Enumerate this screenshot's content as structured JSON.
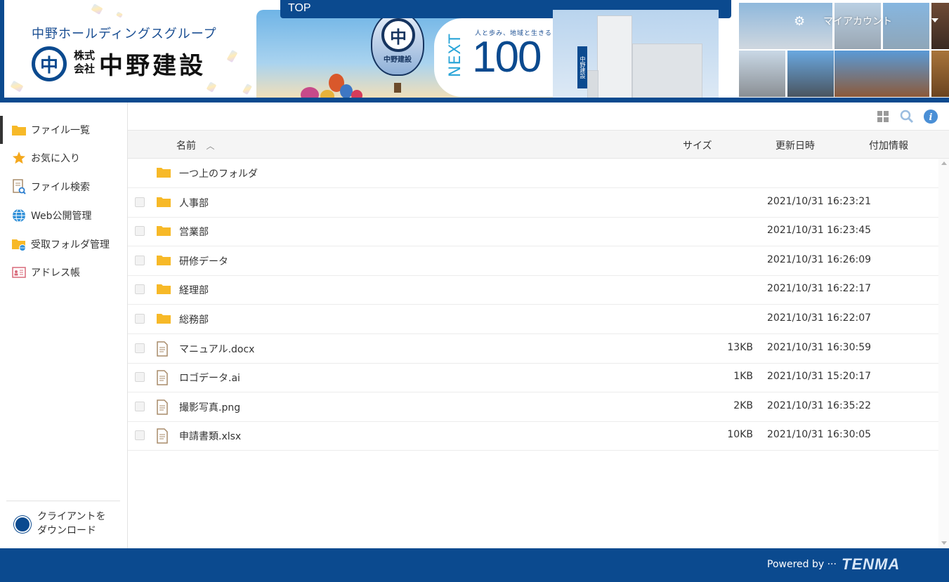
{
  "header": {
    "group_name": "中野ホールディングスグループ",
    "logo_mark": "中",
    "company_type": "株式会社",
    "company_name": "中野建設",
    "top_label": "TOP",
    "balloon_text": "中野建設",
    "next_sub": "人と歩み、地域と生きる",
    "next_word": "NEXT",
    "next_number": "100",
    "building_sign": "中野建設",
    "account_label": "マイアカウント",
    "brand_color": "#0b4a8f"
  },
  "sidebar": {
    "items": [
      {
        "label": "ファイル一覧",
        "icon": "folder-icon"
      },
      {
        "label": "お気に入り",
        "icon": "star-icon"
      },
      {
        "label": "ファイル検索",
        "icon": "file-search-icon"
      },
      {
        "label": "Web公開管理",
        "icon": "globe-icon"
      },
      {
        "label": "受取フォルダ管理",
        "icon": "folder-globe-icon"
      },
      {
        "label": "アドレス帳",
        "icon": "address-card-icon"
      }
    ],
    "client_download": "クライアントを\nダウンロード"
  },
  "toolbar": {
    "icons": [
      "grid-view-icon",
      "search-icon",
      "info-icon"
    ]
  },
  "columns": {
    "name": "名前",
    "size": "サイズ",
    "modified": "更新日時",
    "extra": "付加情報"
  },
  "files": [
    {
      "name": "一つ上のフォルダ",
      "type": "folder",
      "size": "",
      "date": "",
      "checkbox": false
    },
    {
      "name": "人事部",
      "type": "folder",
      "size": "",
      "date": "2021/10/31 16:23:21",
      "checkbox": true
    },
    {
      "name": "営業部",
      "type": "folder",
      "size": "",
      "date": "2021/10/31 16:23:45",
      "checkbox": true
    },
    {
      "name": "研修データ",
      "type": "folder",
      "size": "",
      "date": "2021/10/31 16:26:09",
      "checkbox": true
    },
    {
      "name": "経理部",
      "type": "folder",
      "size": "",
      "date": "2021/10/31 16:22:17",
      "checkbox": true
    },
    {
      "name": "総務部",
      "type": "folder",
      "size": "",
      "date": "2021/10/31 16:22:07",
      "checkbox": true
    },
    {
      "name": "マニュアル.docx",
      "type": "file",
      "size": "13KB",
      "date": "2021/10/31 16:30:59",
      "checkbox": true
    },
    {
      "name": "ロゴデータ.ai",
      "type": "file",
      "size": "1KB",
      "date": "2021/10/31 15:20:17",
      "checkbox": true
    },
    {
      "name": "撮影写真.png",
      "type": "file",
      "size": "2KB",
      "date": "2021/10/31 16:35:22",
      "checkbox": true
    },
    {
      "name": "申請書類.xlsx",
      "type": "file",
      "size": "10KB",
      "date": "2021/10/31 16:30:05",
      "checkbox": true
    }
  ],
  "footer": {
    "powered_by": "Powered by ···",
    "brand": "TENMA"
  }
}
